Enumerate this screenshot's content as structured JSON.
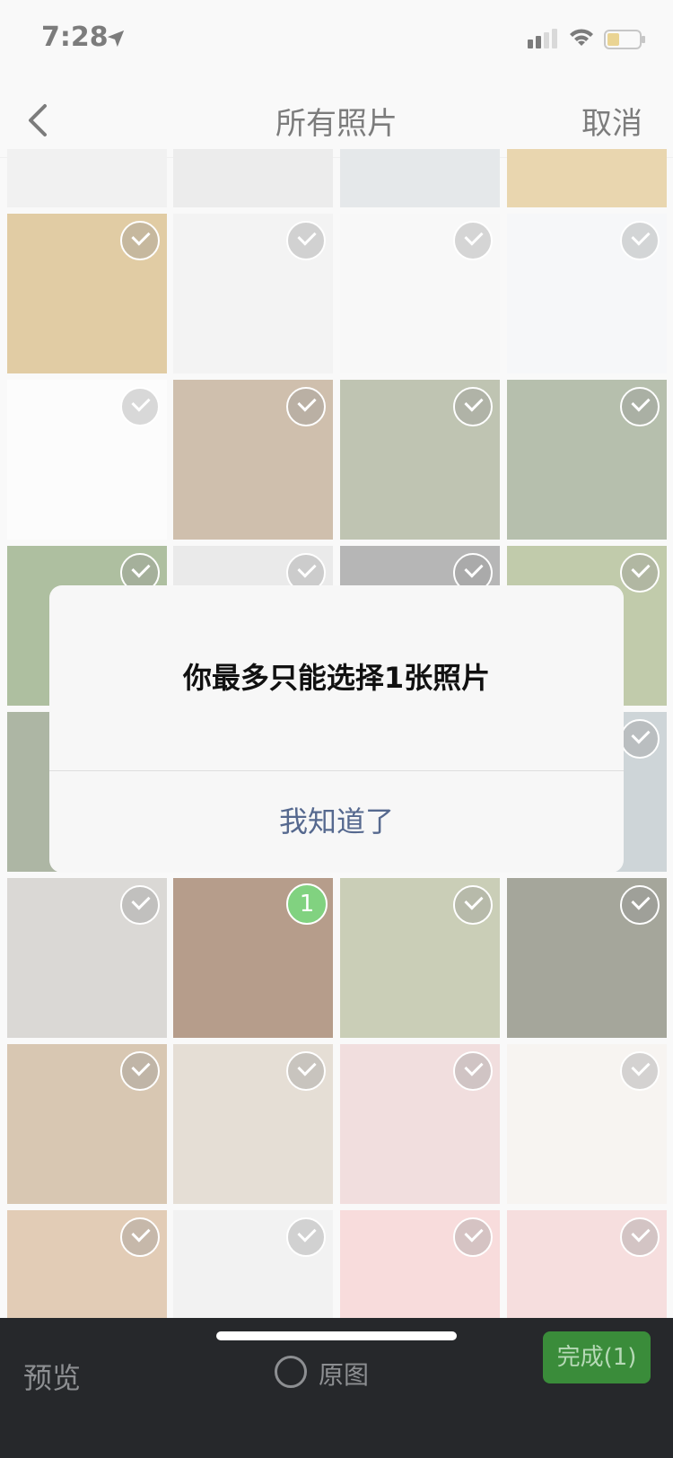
{
  "status_bar": {
    "time": "7:28"
  },
  "nav": {
    "title": "所有照片",
    "cancel_label": "取消"
  },
  "dialog": {
    "message": "你最多只能选择1张照片",
    "confirm_label": "我知道了"
  },
  "bottom_bar": {
    "preview_label": "预览",
    "original_label": "原图",
    "done_label": "完成(1)"
  },
  "grid": {
    "selected_badge": "1",
    "tiles": [
      {
        "name": "photo-giraffes",
        "color": "#c8a35a"
      },
      {
        "name": "photo-document-fish",
        "color": "#e9e9e9"
      },
      {
        "name": "photo-ui-screenshot",
        "color": "#f3f3f3"
      },
      {
        "name": "photo-fish-cards",
        "color": "#eef1f4"
      },
      {
        "name": "photo-text-document",
        "color": "#fafafa"
      },
      {
        "name": "photo-squirrel",
        "color": "#a88b6b"
      },
      {
        "name": "photo-chameleon",
        "color": "#8a9474"
      },
      {
        "name": "photo-lanternfly",
        "color": "#7b8a6a"
      },
      {
        "name": "photo-bird",
        "color": "#6c8a52"
      },
      {
        "name": "photo-pink-bird",
        "color": "#d9d9d9"
      },
      {
        "name": "photo-cat-gray",
        "color": "#7b7b7b"
      },
      {
        "name": "photo-hedgehog",
        "color": "#8fa066"
      },
      {
        "name": "photo-bird-2",
        "color": "#6a7b5a"
      },
      {
        "name": "photo-gray-3",
        "color": "#b9b9b9"
      },
      {
        "name": "photo-gray-4",
        "color": "#c4c4c4"
      },
      {
        "name": "photo-seal",
        "color": "#a7b3b8"
      },
      {
        "name": "photo-ermine",
        "color": "#bcb8b2"
      },
      {
        "name": "photo-fennec-fox",
        "color": "#7a4e2c"
      },
      {
        "name": "photo-anteater",
        "color": "#9ea67c"
      },
      {
        "name": "photo-cows",
        "color": "#5b5e4a"
      },
      {
        "name": "photo-puma",
        "color": "#b89a74"
      },
      {
        "name": "photo-kitten",
        "color": "#cfc3b3"
      },
      {
        "name": "photo-hamster",
        "color": "#e5c3c4"
      },
      {
        "name": "photo-text-post",
        "color": "#f0ece6"
      },
      {
        "name": "photo-orange-cat",
        "color": "#caa27a"
      },
      {
        "name": "photo-collage",
        "color": "#e8e8e8"
      },
      {
        "name": "photo-tips-star-1",
        "color": "#f2c0c0"
      },
      {
        "name": "photo-tips-star-2",
        "color": "#efc4c4"
      }
    ]
  }
}
